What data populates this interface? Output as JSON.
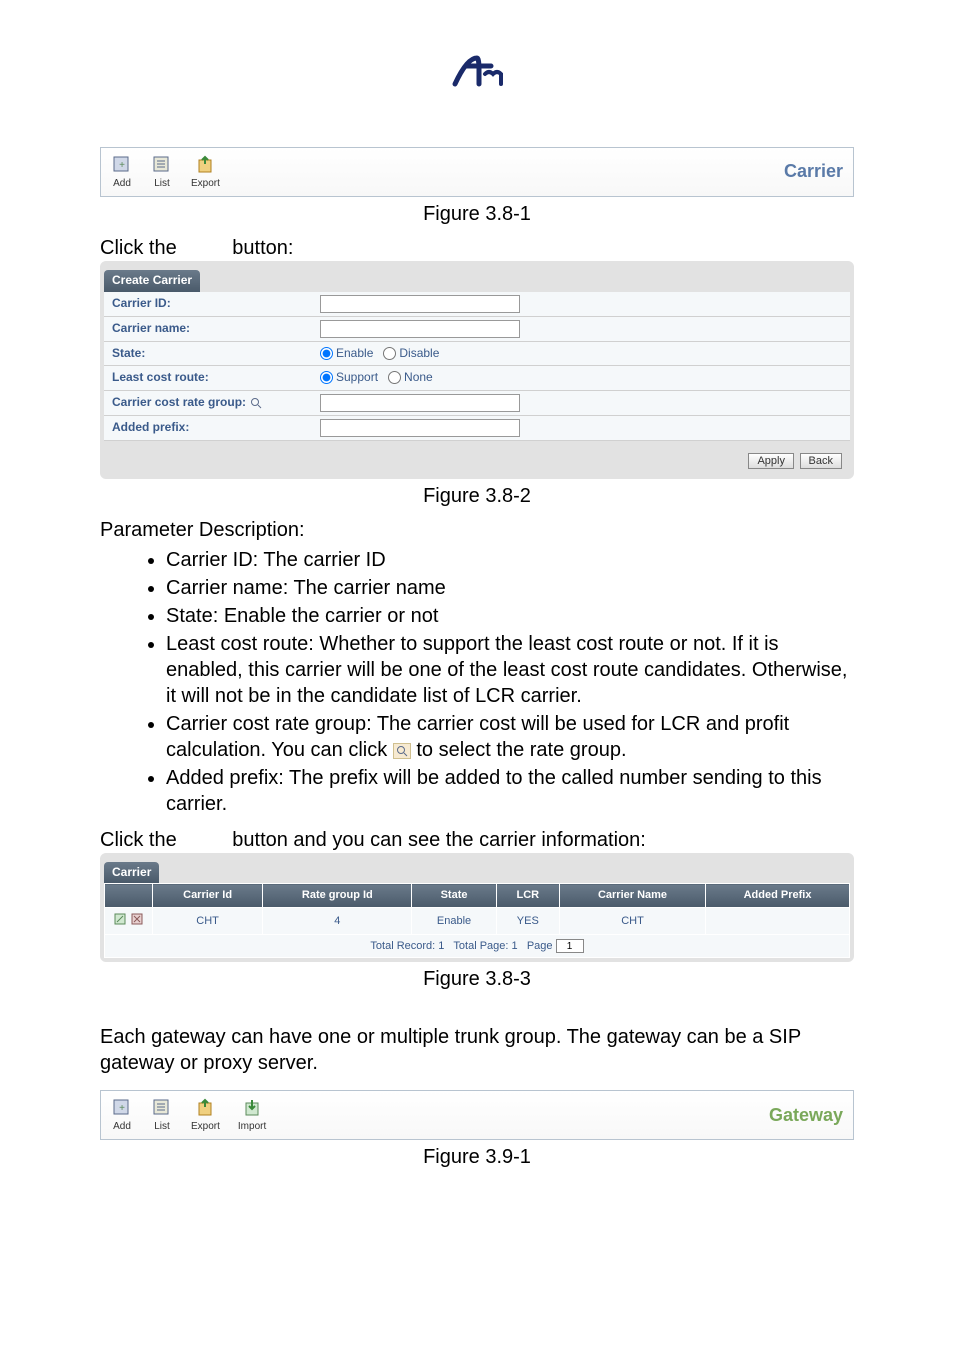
{
  "logo_alt": "tm",
  "toolbar1": {
    "items": [
      {
        "label": "Add",
        "icon": "add-icon"
      },
      {
        "label": "List",
        "icon": "list-icon"
      },
      {
        "label": "Export",
        "icon": "export-icon"
      }
    ],
    "title": "Carrier"
  },
  "captions": {
    "fig_3_8_1": "Figure 3.8-1",
    "fig_3_8_2": "Figure 3.8-2",
    "fig_3_8_3": "Figure 3.8-3",
    "fig_3_9_1": "Figure 3.9-1"
  },
  "text": {
    "click_add_prefix": "Click the ",
    "click_add_suffix": " button:",
    "param_desc": "Parameter Description:",
    "click_list_prefix": "Click the ",
    "click_list_suffix": " button and you can see the carrier information:",
    "gateway_para": "Each gateway can have one or multiple trunk group. The gateway can be a SIP gateway or proxy server."
  },
  "bullets": {
    "b1": "Carrier ID: The carrier ID",
    "b2": "Carrier name: The carrier name",
    "b3": "State: Enable the carrier or not",
    "b4": "Least cost route: Whether to support the least cost route or not. If it is enabled, this carrier will be one of the least cost route candidates. Otherwise, it will not be in the candidate list of LCR carrier.",
    "b5": "Carrier cost rate group: The carrier cost will be used for LCR and profit calculation. You can click ",
    "b5_suffix": " to select the rate group.",
    "b6": "Added prefix: The prefix will be added to the called number sending to this carrier."
  },
  "form": {
    "header": "Create Carrier",
    "rows": {
      "carrier_id": "Carrier ID:",
      "carrier_name": "Carrier name:",
      "state": "State:",
      "lcr": "Least cost route:",
      "rate_group": "Carrier cost rate group:",
      "added_prefix": "Added prefix:"
    },
    "radios": {
      "enable": "Enable",
      "disable": "Disable",
      "support": "Support",
      "none": "None"
    },
    "buttons": {
      "apply": "Apply",
      "back": "Back"
    }
  },
  "carrier_table": {
    "header": "Carrier",
    "columns": [
      "",
      "Carrier Id",
      "Rate group Id",
      "State",
      "LCR",
      "Carrier Name",
      "Added Prefix"
    ],
    "row": {
      "carrier_id": "CHT",
      "rate_group_id": "4",
      "state": "Enable",
      "lcr": "YES",
      "carrier_name": "CHT",
      "added_prefix": ""
    },
    "footer": {
      "total_record_label": "Total Record:",
      "total_record": "1",
      "total_page_label": "Total Page:",
      "total_page": "1",
      "page_label": "Page",
      "page": "1"
    }
  },
  "toolbar2": {
    "items": [
      {
        "label": "Add",
        "icon": "add-icon"
      },
      {
        "label": "List",
        "icon": "list-icon"
      },
      {
        "label": "Export",
        "icon": "export-icon"
      },
      {
        "label": "Import",
        "icon": "import-icon"
      }
    ],
    "title": "Gateway"
  }
}
